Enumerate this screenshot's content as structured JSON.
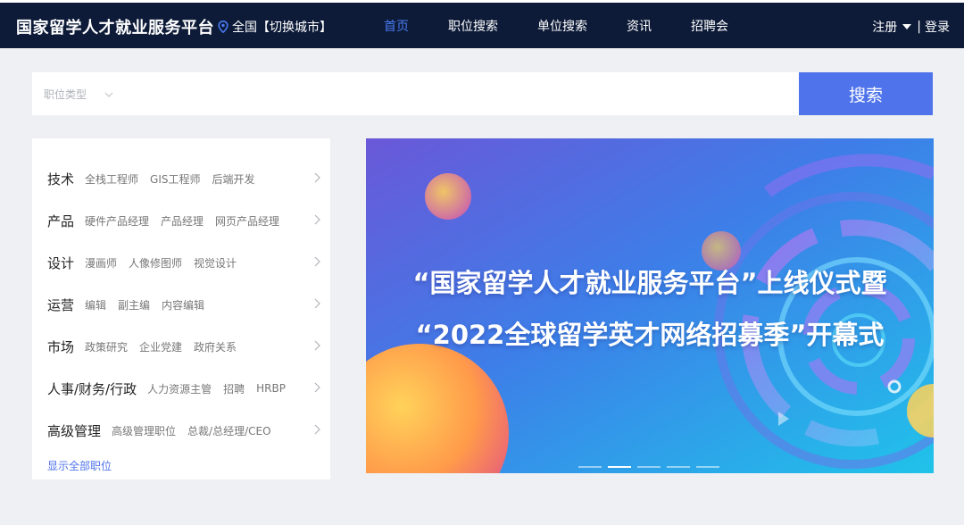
{
  "header": {
    "brand": "国家留学人才就业服务平台",
    "location": "全国【切换城市】",
    "nav": [
      "首页",
      "职位搜索",
      "单位搜索",
      "资讯",
      "招聘会"
    ],
    "active_nav": 0,
    "register": "注册",
    "separator": "|",
    "login": "登录"
  },
  "search": {
    "job_type_placeholder": "职位类型",
    "button": "搜索"
  },
  "categories": [
    {
      "title": "技术",
      "subs": [
        "全栈工程师",
        "GIS工程师",
        "后端开发"
      ]
    },
    {
      "title": "产品",
      "subs": [
        "硬件产品经理",
        "产品经理",
        "网页产品经理"
      ]
    },
    {
      "title": "设计",
      "subs": [
        "漫画师",
        "人像修图师",
        "视觉设计"
      ]
    },
    {
      "title": "运营",
      "subs": [
        "编辑",
        "副主编",
        "内容编辑"
      ]
    },
    {
      "title": "市场",
      "subs": [
        "政策研究",
        "企业党建",
        "政府关系"
      ]
    },
    {
      "title": "人事/财务/行政",
      "subs": [
        "人力资源主管",
        "招聘",
        "HRBP"
      ]
    },
    {
      "title": "高级管理",
      "subs": [
        "高级管理职位",
        "总裁/总经理/CEO"
      ]
    }
  ],
  "show_all": "显示全部职位",
  "banner": {
    "line1": "“国家留学人才就业服务平台”上线仪式暨",
    "line2": "“2022全球留学英才网络招募季”开幕式",
    "slide_count": 5,
    "active_slide": 1
  },
  "colors": {
    "header_bg": "#0d1b38",
    "accent": "#4f73ea",
    "active_nav": "#4a7bf2"
  }
}
